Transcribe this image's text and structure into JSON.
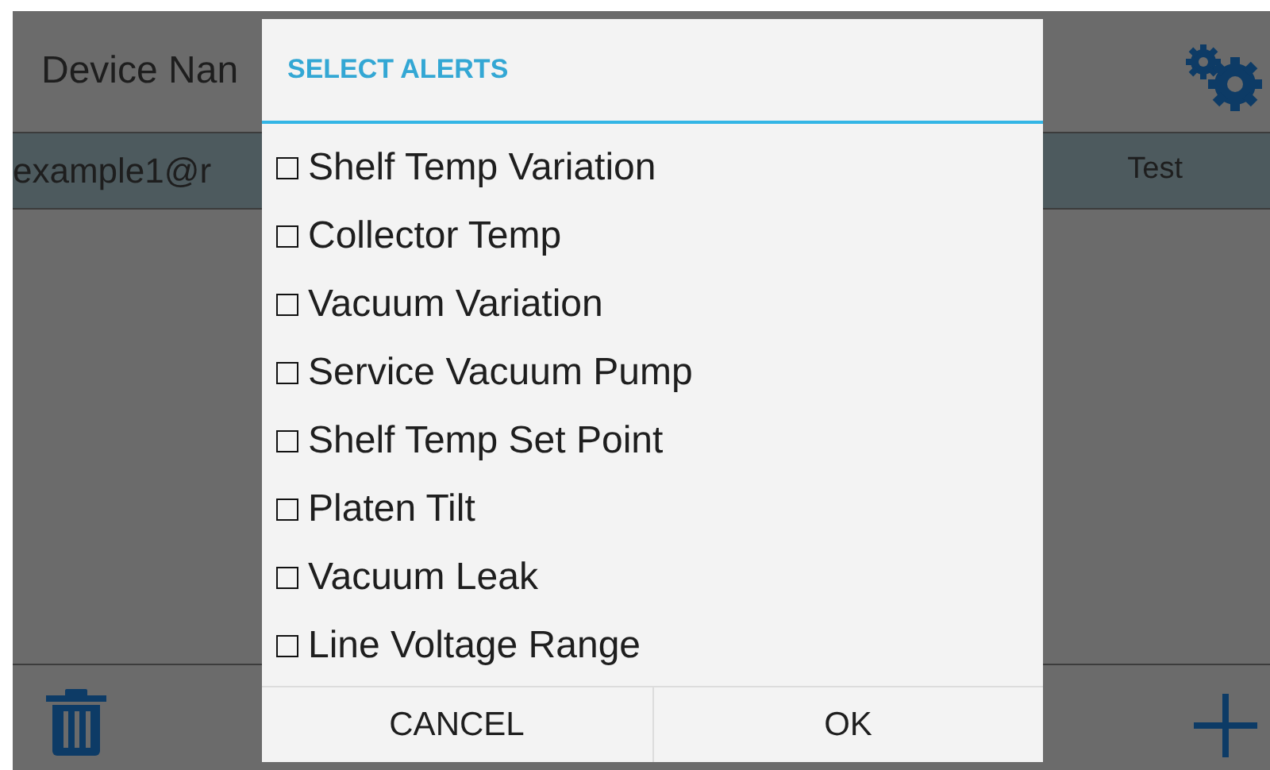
{
  "header": {
    "title": "Device Nan"
  },
  "row": {
    "email": "example1@r",
    "action": "Test"
  },
  "dialog": {
    "title": "SELECT ALERTS",
    "items": [
      {
        "label": "Shelf Temp Variation",
        "checked": false
      },
      {
        "label": "Collector Temp",
        "checked": false
      },
      {
        "label": "Vacuum Variation",
        "checked": false
      },
      {
        "label": "Service Vacuum Pump",
        "checked": false
      },
      {
        "label": "Shelf Temp Set Point",
        "checked": false
      },
      {
        "label": "Platen Tilt",
        "checked": false
      },
      {
        "label": "Vacuum Leak",
        "checked": false
      },
      {
        "label": "Line Voltage Range",
        "checked": false
      }
    ],
    "buttons": [
      "CANCEL",
      "OK"
    ]
  }
}
